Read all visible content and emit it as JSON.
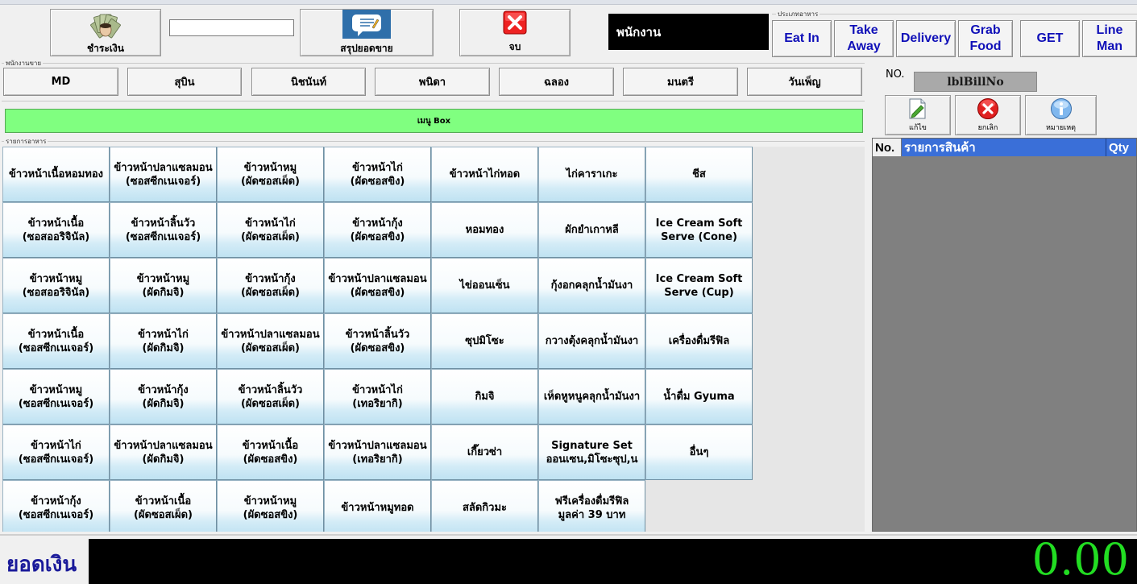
{
  "toolbar": {
    "pay_label": "ชำระเงิน",
    "search_value": "",
    "summary_label": "สรุปยอดขาย",
    "exit_label": "จบ",
    "staff_display": "พนักงาน"
  },
  "order_type": {
    "group_label": "ประเภทอาหาร",
    "buttons": [
      "Eat In",
      "Take\nAway",
      "Delivery",
      "Grab\nFood",
      "GET",
      "Line\nMan"
    ]
  },
  "staff": {
    "group_label": "พนักงานขาย",
    "buttons": [
      "MD",
      "สุบิน",
      "นิชนันท์",
      "พนิดา",
      "ฉลอง",
      "มนตรี",
      "วันเพ็ญ"
    ]
  },
  "menu_box": {
    "label": "เมนู Box"
  },
  "menu": {
    "group_label": "รายการอาหาร",
    "items": [
      "ข้าวหน้าเนื้อหอมทอง",
      "ข้าวหน้าปลาแซลมอน\n(ซอสซีกเนเจอร์)",
      "ข้าวหน้าหมู\n(ผัดซอสเผ็ด)",
      "ข้าวหน้าไก่\n(ผัดซอสขิง)",
      "ข้าวหน้าไก่ทอด",
      "ไก่คาราเกะ",
      "ชีส",
      "ข้าวหน้าเนื้อ\n(ซอสออริจินัล)",
      "ข้าวหน้าลิ้นวัว\n(ซอสซีกเนเจอร์)",
      "ข้าวหน้าไก่\n(ผัดซอสเผ็ด)",
      "ข้าวหน้ากุ้ง\n(ผัดซอสขิง)",
      "หอมทอง",
      "ผักยำเกาหลี",
      "Ice Cream Soft\nServe (Cone)",
      "ข้าวหน้าหมู\n(ซอสออริจินัล)",
      "ข้าวหน้าหมู\n(ผัดกิมจิ)",
      "ข้าวหน้ากุ้ง\n(ผัดซอสเผ็ด)",
      "ข้าวหน้าปลาแซลมอน\n(ผัดซอสขิง)",
      "ไข่ออนเซ็น",
      "กุ้งอกคลุกน้ำมันงา",
      "Ice Cream Soft\nServe (Cup)",
      "ข้าวหน้าเนื้อ\n(ซอสซีกเนเจอร์)",
      "ข้าวหน้าไก่\n(ผัดกิมจิ)",
      "ข้าวหน้าปลาแซลมอน\n(ผัดซอสเผ็ด)",
      "ข้าวหน้าลิ้นวัว\n(ผัดซอสขิง)",
      "ซุปมิโซะ",
      "กวางตุ้งคลุกน้ำมันงา",
      "เครื่องดื่มรีฟิล",
      "ข้าวหน้าหมู\n(ซอสซีกเนเจอร์)",
      "ข้าวหน้ากุ้ง\n(ผัดกิมจิ)",
      "ข้าวหน้าลิ้นวัว\n(ผัดซอสเผ็ด)",
      "ข้าวหน้าไก่\n(เทอริยากิ)",
      "กิมจิ",
      "เห็ดหูหนูคลุกน้ำมันงา",
      "น้ำดื่ม Gyuma",
      "ข้าวหน้าไก่\n(ซอสซีกเนเจอร์)",
      "ข้าวหน้าปลาแซลมอน\n(ผัดกิมจิ)",
      "ข้าวหน้าเนื้อ\n(ผัดซอสขิง)",
      "ข้าวหน้าปลาแซลมอน\n(เทอริยากิ)",
      "เกี๊ยวซ่า",
      "Signature Set\nออนเซน,มิโซะซุป,น",
      "อื่นๆ",
      "ข้าวหน้ากุ้ง\n(ซอสซีกเนเจอร์)",
      "ข้าวหน้าเนื้อ\n(ผัดซอสเผ็ด)",
      "ข้าวหน้าหมู\n(ผัดซอสขิง)",
      "ข้าวหน้าหมูทอด",
      "สลัดกิวมะ",
      "ฟรีเครื่องดื่มรีฟิล\nมูลค่า 39 บาท"
    ]
  },
  "bill": {
    "no_label": "NO.",
    "bill_no": "lblBillNo",
    "edit_label": "แก้ไข",
    "cancel_label": "ยกเลิก",
    "note_label": "หมายเหตุ",
    "columns": {
      "no": "No.",
      "item": "รายการสินค้า",
      "qty": "Qty"
    }
  },
  "total": {
    "label": "ยอดเงิน",
    "value": "0.00"
  },
  "colors": {
    "menu_box_bg": "#80ff80",
    "order_text": "#1010b8",
    "total_text": "#22dd22",
    "header_blue": "#3a6fd8"
  }
}
